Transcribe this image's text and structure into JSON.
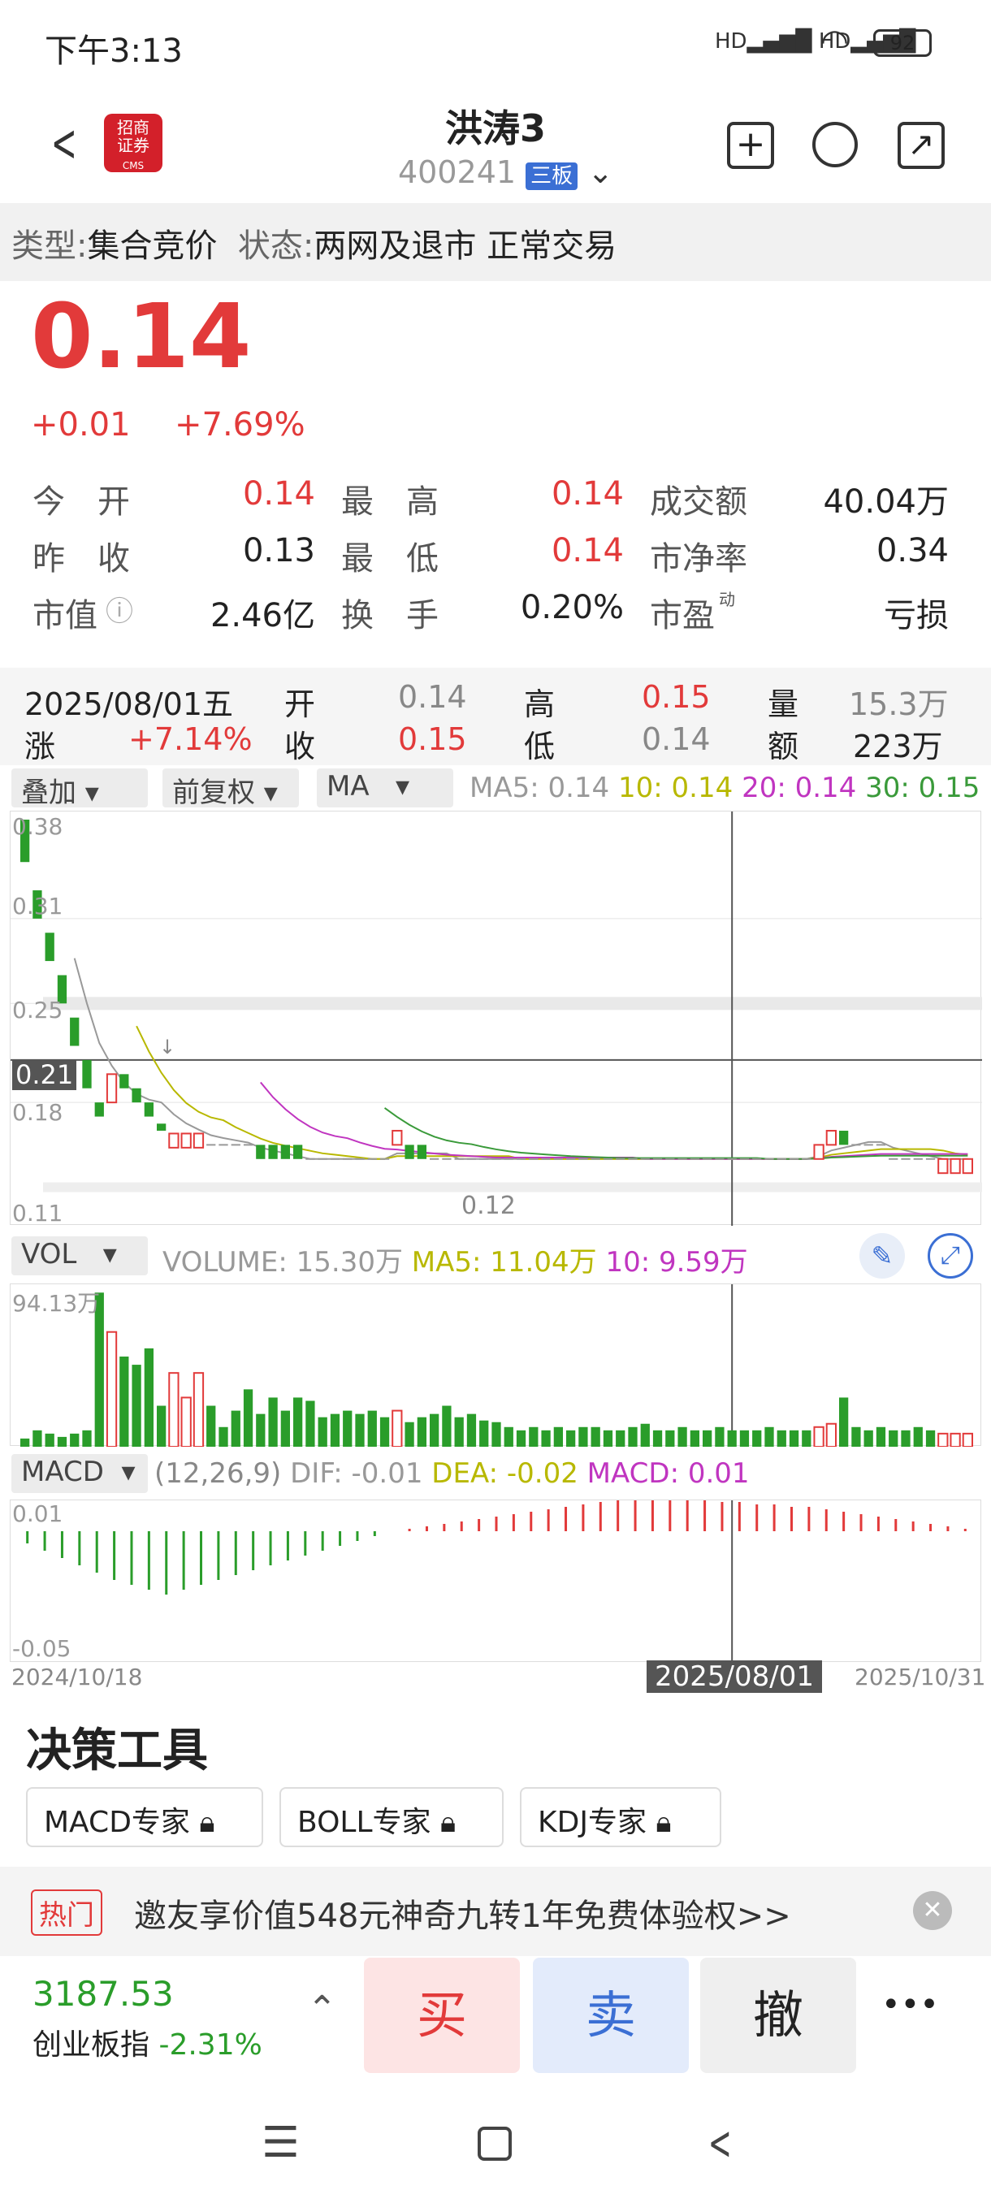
{
  "status": {
    "time": "下午3:13",
    "battery": "92"
  },
  "header": {
    "title": "洪涛3",
    "code": "400241",
    "board": "三板",
    "logo_text": "招商\n证券",
    "logo_sub": "CMS"
  },
  "type_bar": {
    "type_label": "类型:",
    "type_value": "集合竞价",
    "state_label": "状态:",
    "state_value": "两网及退市 正常交易"
  },
  "quote": {
    "price": "0.14",
    "change": "+0.01",
    "change_pct": "+7.69%",
    "rows": [
      [
        {
          "l": "今　开",
          "v": "0.14",
          "c": "red"
        },
        {
          "l": "最　高",
          "v": "0.14",
          "c": "red"
        },
        {
          "l": "成交额",
          "v": "40.04万",
          "c": "black"
        }
      ],
      [
        {
          "l": "昨　收",
          "v": "0.13",
          "c": "black"
        },
        {
          "l": "最　低",
          "v": "0.14",
          "c": "red"
        },
        {
          "l": "市净率",
          "v": "0.34",
          "c": "black"
        }
      ],
      [
        {
          "l": "市值",
          "v": "2.46亿",
          "c": "black"
        },
        {
          "l": "换　手",
          "v": "0.20%",
          "c": "black"
        },
        {
          "l": "市盈",
          "v": "亏损",
          "c": "black"
        }
      ]
    ],
    "pe_sup": "动"
  },
  "kline_info": {
    "date": "2025/08/01五",
    "open_l": "开",
    "open": "0.14",
    "high_l": "高",
    "high": "0.15",
    "vol_l": "量",
    "vol": "15.3万",
    "chg_l": "涨",
    "chg": "+7.14%",
    "close_l": "收",
    "close": "0.15",
    "low_l": "低",
    "low": "0.14",
    "amt_l": "额",
    "amt": "223万"
  },
  "toolbar": {
    "overlay": "叠加",
    "adjust": "前复权",
    "ma": "MA",
    "ma5": "MA5: 0.14",
    "ma10": "10: 0.14",
    "ma20": "20: 0.14",
    "ma30": "30: 0.15"
  },
  "price_axis": {
    "p1": "0.38",
    "p2": "0.31",
    "p3": "0.25",
    "p4": "0.21",
    "p5": "0.18",
    "p6": "0.11",
    "min_mark": "0.12",
    "max_mark": "↓"
  },
  "vol_bar": {
    "label": "VOL",
    "volume": "VOLUME: 15.30万",
    "ma5": "MA5: 11.04万",
    "ma10": "10: 9.59万",
    "axis_top": "94.13万"
  },
  "macd_bar": {
    "label": "MACD",
    "params": "(12,26,9)",
    "dif": "DIF: -0.01",
    "dea": "DEA: -0.02",
    "macd": "MACD: 0.01",
    "axis_top": "0.01",
    "axis_bottom": "-0.05"
  },
  "dates": {
    "start": "2024/10/18",
    "cursor": "2025/08/01",
    "end": "2025/10/31"
  },
  "tools": {
    "title": "决策工具",
    "b1": "MACD专家",
    "b2": "BOLL专家",
    "b3": "KDJ专家"
  },
  "hot": {
    "tag": "热门",
    "text": "邀友享价值548元神奇九转1年免费体验权>>"
  },
  "bottom": {
    "index_value": "3187.53",
    "index_name": "创业板指",
    "index_chg": "-2.31%",
    "buy": "买",
    "sell": "卖",
    "cancel": "撤",
    "more": "•••"
  },
  "colors": {
    "up": "#e23a3a",
    "down": "#2a9d2a",
    "ma5": "#b8b800",
    "ma10": "#b8b800",
    "ma20": "#c035c0",
    "ma30": "#3a9a3a",
    "accent": "#3b6fd4"
  },
  "chart_data": {
    "type": "candlestick",
    "candles": [
      {
        "o": 0.38,
        "c": 0.35
      },
      {
        "o": 0.33,
        "c": 0.31
      },
      {
        "o": 0.3,
        "c": 0.28
      },
      {
        "o": 0.27,
        "c": 0.25
      },
      {
        "o": 0.24,
        "c": 0.22
      },
      {
        "o": 0.21,
        "c": 0.19
      },
      {
        "o": 0.18,
        "c": 0.17
      },
      {
        "o": 0.18,
        "c": 0.2
      },
      {
        "o": 0.2,
        "c": 0.19
      },
      {
        "o": 0.19,
        "c": 0.18
      },
      {
        "o": 0.18,
        "c": 0.17
      },
      {
        "o": 0.165,
        "c": 0.16
      },
      {
        "o": 0.148,
        "c": 0.158
      },
      {
        "o": 0.148,
        "c": 0.158
      },
      {
        "o": 0.148,
        "c": 0.158
      },
      {
        "o": 0.15,
        "c": 0.15
      },
      {
        "o": 0.15,
        "c": 0.15
      },
      {
        "o": 0.15,
        "c": 0.15
      },
      {
        "o": 0.15,
        "c": 0.15
      },
      {
        "o": 0.15,
        "c": 0.14
      },
      {
        "o": 0.15,
        "c": 0.14
      },
      {
        "o": 0.15,
        "c": 0.14
      },
      {
        "o": 0.15,
        "c": 0.14
      },
      {
        "o": 0.14,
        "c": 0.14
      },
      {
        "o": 0.14,
        "c": 0.14
      },
      {
        "o": 0.14,
        "c": 0.14
      },
      {
        "o": 0.14,
        "c": 0.14
      },
      {
        "o": 0.14,
        "c": 0.14
      },
      {
        "o": 0.14,
        "c": 0.14
      },
      {
        "o": 0.14,
        "c": 0.14
      },
      {
        "o": 0.15,
        "c": 0.16
      },
      {
        "o": 0.15,
        "c": 0.14
      },
      {
        "o": 0.15,
        "c": 0.14
      },
      {
        "o": 0.14,
        "c": 0.14
      },
      {
        "o": 0.14,
        "c": 0.14
      },
      {
        "o": 0.14,
        "c": 0.14
      },
      {
        "o": 0.14,
        "c": 0.14
      },
      {
        "o": 0.14,
        "c": 0.14
      },
      {
        "o": 0.14,
        "c": 0.14
      },
      {
        "o": 0.14,
        "c": 0.14
      },
      {
        "o": 0.14,
        "c": 0.14
      },
      {
        "o": 0.14,
        "c": 0.14
      },
      {
        "o": 0.14,
        "c": 0.14
      },
      {
        "o": 0.14,
        "c": 0.14
      },
      {
        "o": 0.14,
        "c": 0.14
      },
      {
        "o": 0.14,
        "c": 0.14
      },
      {
        "o": 0.14,
        "c": 0.14
      },
      {
        "o": 0.14,
        "c": 0.14
      },
      {
        "o": 0.14,
        "c": 0.14
      },
      {
        "o": 0.14,
        "c": 0.14
      },
      {
        "o": 0.14,
        "c": 0.14
      },
      {
        "o": 0.14,
        "c": 0.14
      },
      {
        "o": 0.14,
        "c": 0.14
      },
      {
        "o": 0.14,
        "c": 0.14
      },
      {
        "o": 0.14,
        "c": 0.14
      },
      {
        "o": 0.14,
        "c": 0.14
      },
      {
        "o": 0.14,
        "c": 0.14
      },
      {
        "o": 0.14,
        "c": 0.14
      },
      {
        "o": 0.14,
        "c": 0.14
      },
      {
        "o": 0.14,
        "c": 0.14
      },
      {
        "o": 0.14,
        "c": 0.14
      },
      {
        "o": 0.14,
        "c": 0.14
      },
      {
        "o": 0.14,
        "c": 0.14
      },
      {
        "o": 0.14,
        "c": 0.14
      },
      {
        "o": 0.14,
        "c": 0.15
      },
      {
        "o": 0.15,
        "c": 0.16
      },
      {
        "o": 0.16,
        "c": 0.15
      },
      {
        "o": 0.15,
        "c": 0.15
      },
      {
        "o": 0.15,
        "c": 0.15
      },
      {
        "o": 0.15,
        "c": 0.15
      },
      {
        "o": 0.14,
        "c": 0.14
      },
      {
        "o": 0.14,
        "c": 0.14
      },
      {
        "o": 0.14,
        "c": 0.14
      },
      {
        "o": 0.14,
        "c": 0.14
      },
      {
        "o": 0.13,
        "c": 0.14
      },
      {
        "o": 0.13,
        "c": 0.14
      },
      {
        "o": 0.13,
        "c": 0.14
      }
    ],
    "price_range": [
      0.11,
      0.38
    ],
    "volumes": [
      5,
      10,
      8,
      6,
      8,
      10,
      94,
      70,
      55,
      50,
      60,
      25,
      45,
      30,
      45,
      25,
      12,
      22,
      35,
      20,
      30,
      22,
      30,
      28,
      18,
      20,
      22,
      20,
      22,
      18,
      22,
      15,
      18,
      20,
      25,
      18,
      20,
      16,
      15,
      12,
      10,
      12,
      10,
      12,
      10,
      12,
      12,
      10,
      10,
      12,
      14,
      10,
      10,
      12,
      10,
      10,
      12,
      10,
      10,
      10,
      12,
      10,
      10,
      10,
      12,
      14,
      30,
      12,
      10,
      12,
      10,
      10,
      12,
      10,
      8,
      8,
      8,
      8
    ],
    "vol_max": 94.13,
    "macd_hist": [
      -0.005,
      -0.008,
      -0.011,
      -0.014,
      -0.017,
      -0.02,
      -0.022,
      -0.024,
      -0.026,
      -0.024,
      -0.022,
      -0.02,
      -0.018,
      -0.016,
      -0.014,
      -0.012,
      -0.01,
      -0.008,
      -0.006,
      -0.004,
      -0.002,
      0.0,
      0.001,
      0.002,
      0.003,
      0.004,
      0.005,
      0.006,
      0.007,
      0.008,
      0.009,
      0.01,
      0.011,
      0.012,
      0.013,
      0.013,
      0.013,
      0.013,
      0.013,
      0.013,
      0.012,
      0.012,
      0.011,
      0.011,
      0.01,
      0.01,
      0.009,
      0.008,
      0.007,
      0.006,
      0.005,
      0.004,
      0.003,
      0.002,
      0.001
    ],
    "macd_range": [
      -0.05,
      0.01
    ]
  }
}
